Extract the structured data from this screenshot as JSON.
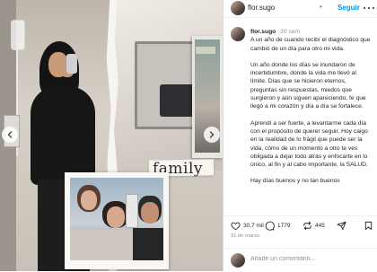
{
  "post": {
    "username": "flor.sugo",
    "follow_label": "Seguir",
    "header_separator": "•"
  },
  "caption": {
    "username": "flor.sugo",
    "time": "20 sem",
    "paragraphs": [
      "A un año de cuando recibí el diagnóstico que cambió de un día para otro mi vida.",
      "Un año donde los días se inundaron de incertidumbre, donde la vida me llevó al límite. Días que se hicieron eternos, preguntas sin respuestas, miedos que surgieron y aún siguen apareciendo, fe que llegó a mi corazón y día a día se fortalece.",
      "Aprendí a ser fuerte, a levantarme cada día con el propósito de querer seguir. Hoy caigo en la realidad de lo frágil que puede ser la vida, cómo de un momento a otro te ves obligada a dejar todo atrás y enfocarte en lo único, al fin y al cabo importante, la SALUD.",
      "Hay días buenos y no tan buenos"
    ]
  },
  "media": {
    "overlay_word": "family"
  },
  "actions": {
    "likes": "30,7 mil",
    "comments": "1779",
    "shares": "445"
  },
  "date": "31 de marzo",
  "comment_box": {
    "placeholder": "Añade un comentario..."
  }
}
